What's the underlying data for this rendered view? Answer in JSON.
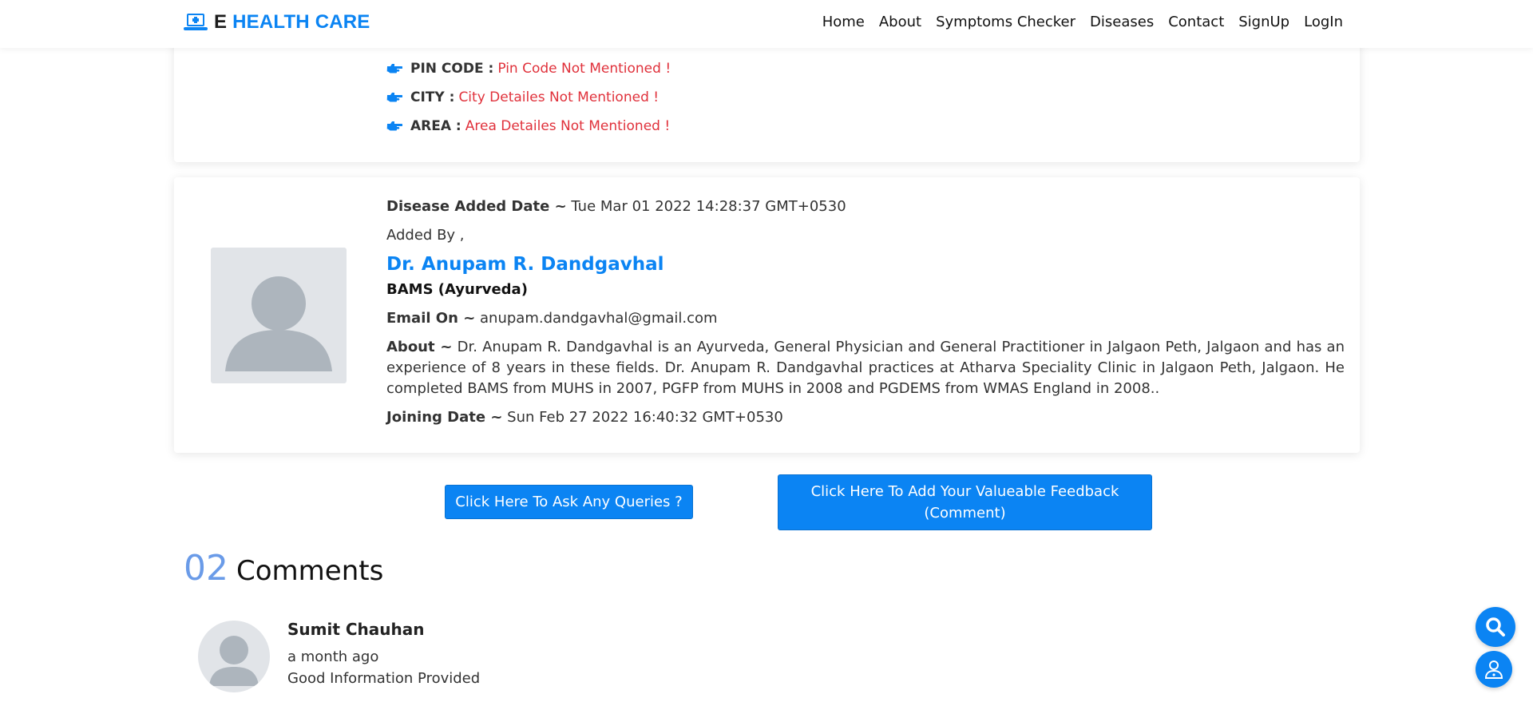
{
  "brand": {
    "prefix": "E",
    "name": "HEALTH CARE",
    "icon": "medical-laptop-icon"
  },
  "nav": [
    {
      "label": "Home"
    },
    {
      "label": "About"
    },
    {
      "label": "Symptoms Checker"
    },
    {
      "label": "Diseases"
    },
    {
      "label": "Contact"
    },
    {
      "label": "SignUp"
    },
    {
      "label": "LogIn"
    }
  ],
  "address": [
    {
      "label": "PIN CODE :",
      "value": "Pin Code Not Mentioned !"
    },
    {
      "label": "CITY :",
      "value": "City Detailes Not Mentioned !"
    },
    {
      "label": "AREA :",
      "value": "Area Detailes Not Mentioned !"
    }
  ],
  "doctor": {
    "added_date_label": "Disease Added Date ~",
    "added_date": "Tue Mar 01 2022 14:28:37 GMT+0530",
    "added_by": "Added By ,",
    "name": "Dr. Anupam R. Dandgavhal",
    "degree": "BAMS (Ayurveda)",
    "email_label": "Email On ~",
    "email": "anupam.dandgavhal@gmail.com",
    "about_label": "About ~",
    "about": "Dr. Anupam R. Dandgavhal is an Ayurveda, General Physician and General Practitioner in Jalgaon Peth, Jalgaon and has an experience of 8 years in these fields. Dr. Anupam R. Dandgavhal practices at Atharva Speciality Clinic in Jalgaon Peth, Jalgaon. He completed BAMS from MUHS in 2007, PGFP from MUHS in 2008 and PGDEMS from WMAS England in 2008..",
    "joining_label": "Joining Date ~",
    "joining_date": "Sun Feb 27 2022 16:40:32 GMT+0530"
  },
  "buttons": {
    "queries": "Click Here To Ask Any Queries ?",
    "feedback": "Click Here To Add Your Valueable Feedback (Comment)"
  },
  "comments": {
    "count": "02",
    "title": "Comments",
    "items": [
      {
        "name": "Sumit Chauhan",
        "time": "a month ago",
        "text": "Good Information Provided"
      }
    ]
  },
  "colors": {
    "accent": "#0b84f3",
    "error": "#e0313b",
    "count": "#6a9be8"
  }
}
